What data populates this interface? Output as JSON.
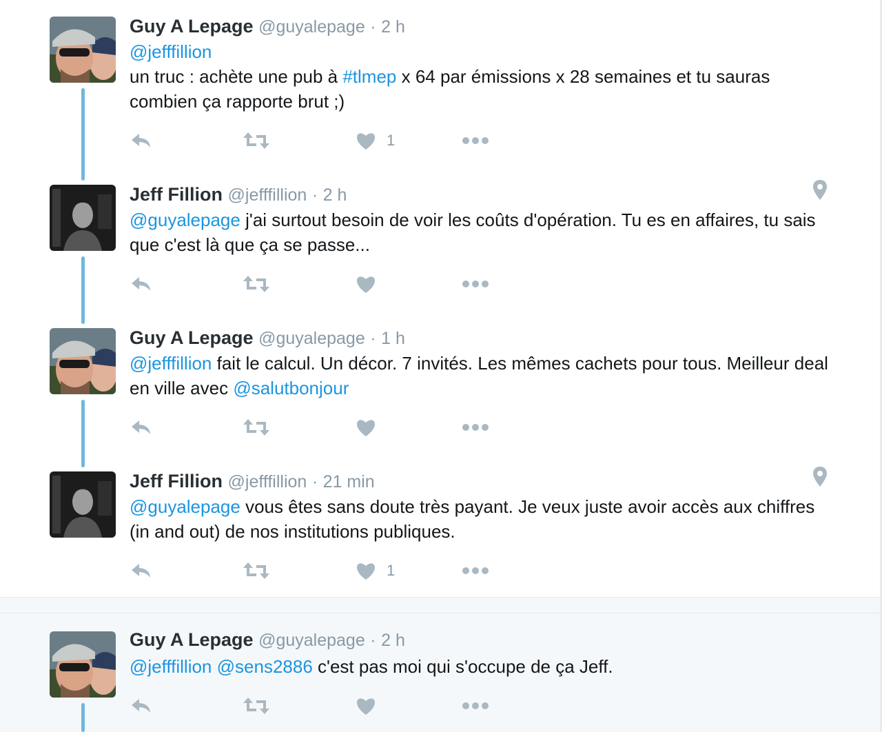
{
  "tweets": [
    {
      "fullname": "Guy A Lepage",
      "username": "@guyalepage",
      "dot": "·",
      "time": "2 h",
      "mention1": "@jefffillion",
      "text_a": "un truc : achète une pub à ",
      "hashtag": "#tlmep",
      "text_b": " x 64 par émissions x 28 semaines et tu sauras combien ça rapporte brut ;)",
      "like_count": "1"
    },
    {
      "fullname": "Jeff Fillion",
      "username": "@jefffillion",
      "dot": "·",
      "time": "2 h",
      "mention1": "@guyalepage",
      "text_a": " j'ai surtout besoin de voir les coûts d'opération. Tu es en affaires, tu sais que c'est là que ça se passe...",
      "like_count": ""
    },
    {
      "fullname": "Guy A Lepage",
      "username": "@guyalepage",
      "dot": "·",
      "time": "1 h",
      "mention1": "@jefffillion",
      "text_a": " fait le calcul. Un décor. 7 invités. Les mêmes cachets pour tous. Meilleur deal en ville avec ",
      "mention2": "@salutbonjour",
      "like_count": ""
    },
    {
      "fullname": "Jeff Fillion",
      "username": "@jefffillion",
      "dot": "·",
      "time": "21 min",
      "mention1": "@guyalepage",
      "text_a": " vous êtes sans doute très payant. Je veux juste avoir accès aux chiffres (in and out) de nos institutions publiques.",
      "like_count": "1"
    },
    {
      "fullname": "Guy A Lepage",
      "username": "@guyalepage",
      "dot": "·",
      "time": "2 h",
      "mention1": "@jefffillion",
      "mention2": "@sens2886",
      "text_a": " c'est pas moi qui s'occupe de ça Jeff.",
      "like_count": ""
    }
  ],
  "icons": {
    "reply": "reply-icon",
    "retweet": "retweet-icon",
    "like": "heart-icon",
    "more": "more-icon",
    "location": "location-pin-icon"
  },
  "colors": {
    "link": "#1b95e0",
    "thread_line": "#6fb7dc",
    "icon_gray": "#aab8c2",
    "secondary_text": "#8899a6",
    "highlight_bg": "#f5f8fa"
  }
}
